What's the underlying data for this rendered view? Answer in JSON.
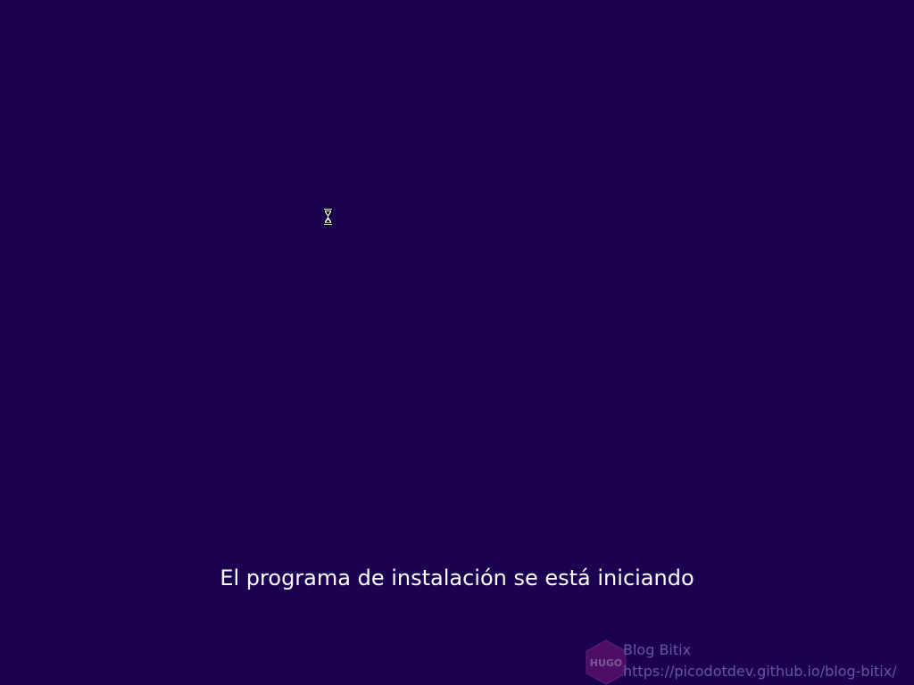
{
  "screen": {
    "background_color": "#1b0052",
    "status_text": "El programa de instalación se está iniciando",
    "cursor_icon": "hourglass-cursor-icon"
  },
  "watermark": {
    "logo_icon": "hugo-logo-icon",
    "logo_text": "HUGO",
    "title": "Blog Bitix",
    "url": "https://picodotdev.github.io/blog-bitix/"
  }
}
